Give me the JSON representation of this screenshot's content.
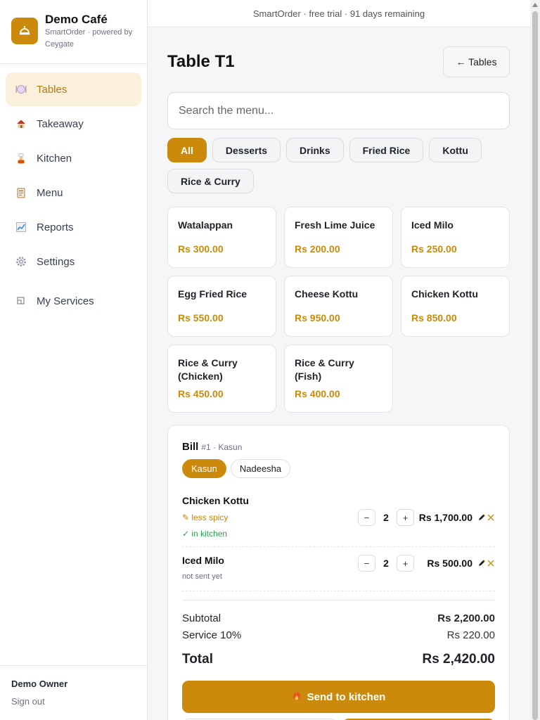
{
  "brand": {
    "name": "Demo Café",
    "subtitle": "SmartOrder · powered by Ceygate"
  },
  "nav": {
    "items": [
      {
        "label": "Tables",
        "icon": "plate-icon",
        "active": true
      },
      {
        "label": "Takeaway",
        "icon": "house-icon"
      },
      {
        "label": "Kitchen",
        "icon": "chef-icon"
      },
      {
        "label": "Menu",
        "icon": "clipboard-icon"
      },
      {
        "label": "Reports",
        "icon": "chart-icon"
      },
      {
        "label": "Settings",
        "icon": "gear-icon"
      },
      {
        "label": "My Services",
        "icon": "services-icon"
      }
    ]
  },
  "user": {
    "name": "Demo Owner",
    "sign_out": "Sign out"
  },
  "topbar": {
    "text": "SmartOrder · free trial · 91 days remaining"
  },
  "page": {
    "title": "Table T1",
    "back_button": "← Tables"
  },
  "search": {
    "placeholder": "Search the menu..."
  },
  "categories": [
    "All",
    "Desserts",
    "Drinks",
    "Fried Rice",
    "Kottu",
    "Rice & Curry"
  ],
  "active_category": "All",
  "menu_items": [
    {
      "name": "Watalappan",
      "price": "Rs 300.00"
    },
    {
      "name": "Fresh Lime Juice",
      "price": "Rs 200.00"
    },
    {
      "name": "Iced Milo",
      "price": "Rs 250.00"
    },
    {
      "name": "Egg Fried Rice",
      "price": "Rs 550.00"
    },
    {
      "name": "Cheese Kottu",
      "price": "Rs 950.00"
    },
    {
      "name": "Chicken Kottu",
      "price": "Rs 850.00"
    },
    {
      "name": "Rice & Curry (Chicken)",
      "price": "Rs 450.00"
    },
    {
      "name": "Rice & Curry (Fish)",
      "price": "Rs 400.00"
    }
  ],
  "bill": {
    "label": "Bill",
    "meta": "#1 · Kasun",
    "diners": [
      "Kasun",
      "Nadeesha"
    ],
    "active_diner": "Kasun",
    "lines": [
      {
        "name": "Chicken Kottu",
        "note": "✎ less spicy",
        "status": "✓ in kitchen",
        "qty": "2",
        "total": "Rs 1,700.00"
      },
      {
        "name": "Iced Milo",
        "status": "not sent yet",
        "qty": "2",
        "total": "Rs 500.00"
      }
    ],
    "subtotal_label": "Subtotal",
    "subtotal": "Rs 2,200.00",
    "service_label": "Service 10%",
    "service": "Rs 220.00",
    "total_label": "Total",
    "total": "Rs 2,420.00",
    "send_button": "Send to kitchen",
    "qty_minus": "−",
    "qty_plus": "+"
  },
  "colors": {
    "accent": "#cc8a0c",
    "accent_light": "#fbf0dc",
    "success": "#2f9e57"
  }
}
